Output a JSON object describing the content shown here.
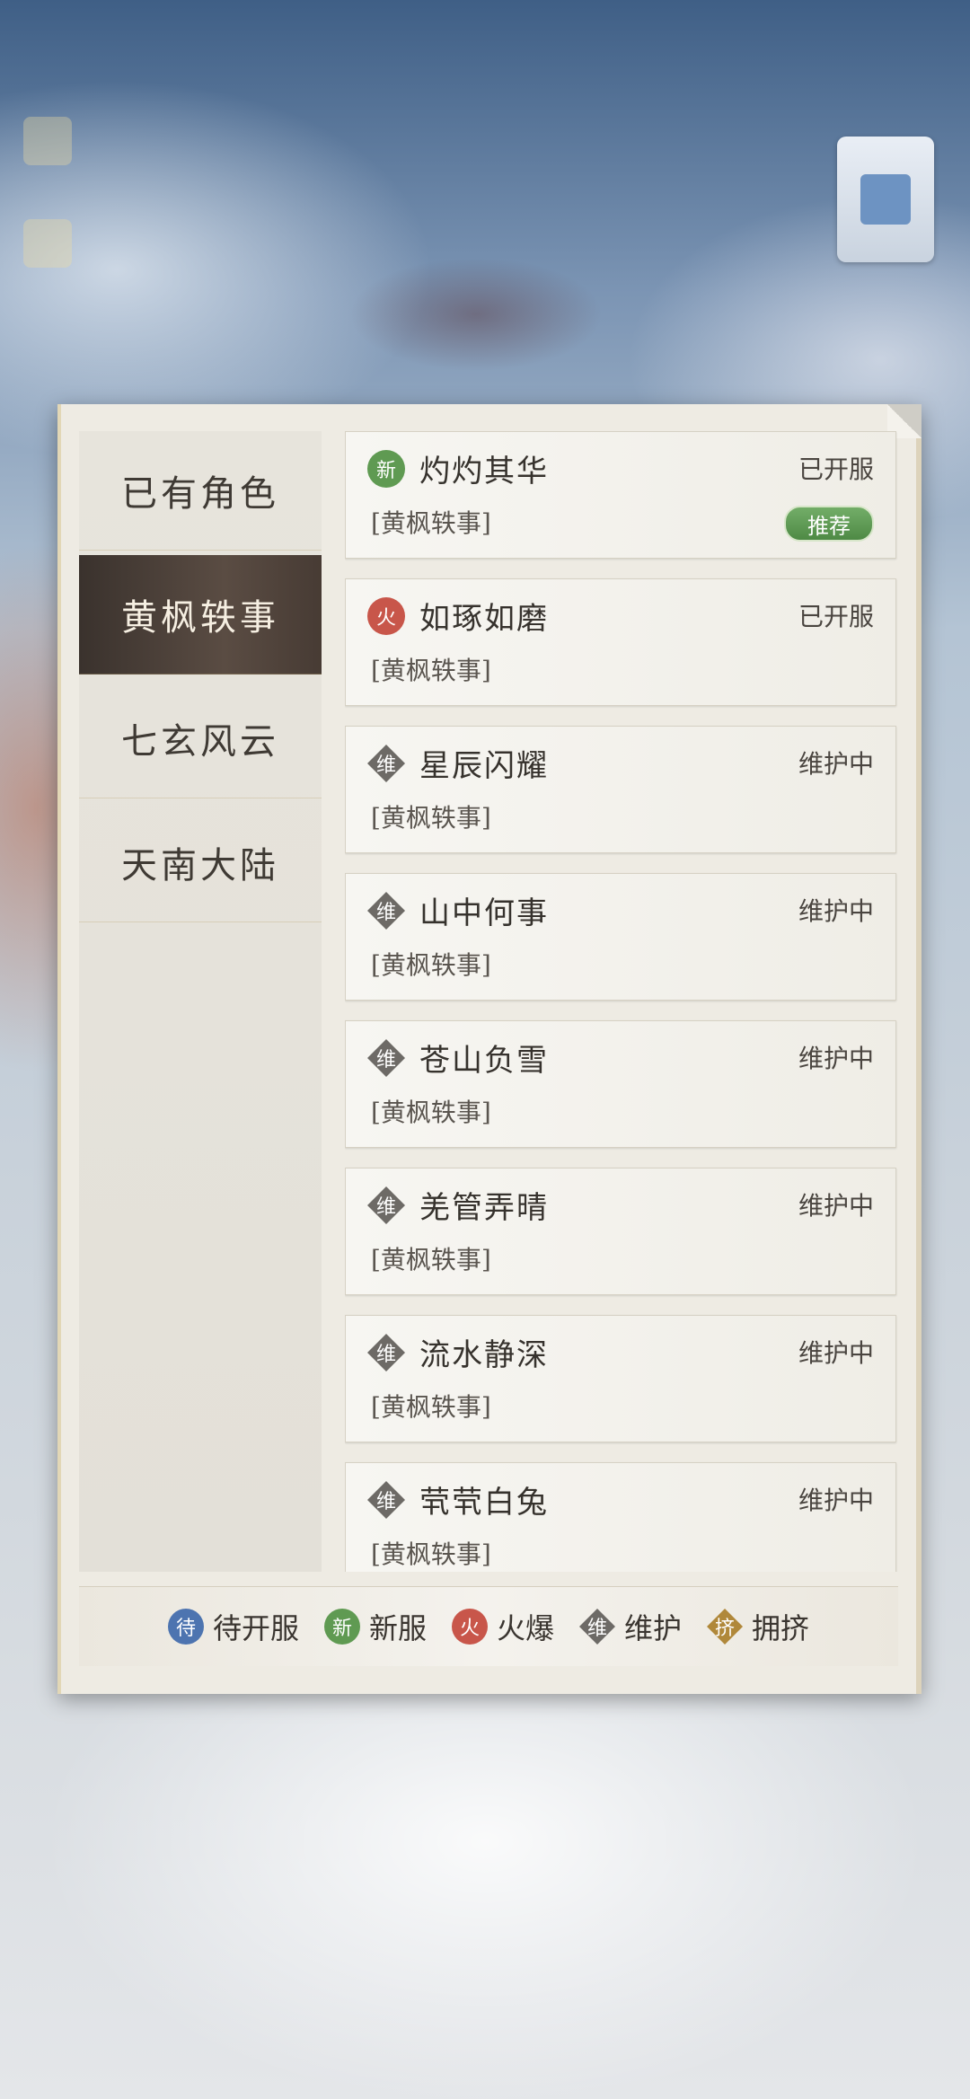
{
  "tabs": [
    {
      "label": "已有角色"
    },
    {
      "label": "黄枫轶事"
    },
    {
      "label": "七玄风云"
    },
    {
      "label": "天南大陆"
    }
  ],
  "active_tab": "黄枫轶事",
  "servers": [
    {
      "badge": "新",
      "name": "灼灼其华",
      "status": "已开服",
      "region": "[黄枫轶事]",
      "tag": "推荐"
    },
    {
      "badge": "火",
      "name": "如琢如磨",
      "status": "已开服",
      "region": "[黄枫轶事]"
    },
    {
      "badge": "维",
      "name": "星辰闪耀",
      "status": "维护中",
      "region": "[黄枫轶事]"
    },
    {
      "badge": "维",
      "name": "山中何事",
      "status": "维护中",
      "region": "[黄枫轶事]"
    },
    {
      "badge": "维",
      "name": "苍山负雪",
      "status": "维护中",
      "region": "[黄枫轶事]"
    },
    {
      "badge": "维",
      "name": "羌管弄晴",
      "status": "维护中",
      "region": "[黄枫轶事]"
    },
    {
      "badge": "维",
      "name": "流水静深",
      "status": "维护中",
      "region": "[黄枫轶事]"
    },
    {
      "badge": "维",
      "name": "茕茕白兔",
      "status": "维护中",
      "region": "[黄枫轶事]"
    }
  ],
  "legend": [
    {
      "badge": "待",
      "label": "待开服",
      "color": "#4d74b0"
    },
    {
      "badge": "新",
      "label": "新服",
      "color": "#5f9a52"
    },
    {
      "badge": "火",
      "label": "火爆",
      "color": "#c8564a"
    },
    {
      "badge": "维",
      "label": "维护",
      "color": "#6d6a66"
    },
    {
      "badge": "挤",
      "label": "拥挤",
      "color": "#b0883a"
    }
  ]
}
